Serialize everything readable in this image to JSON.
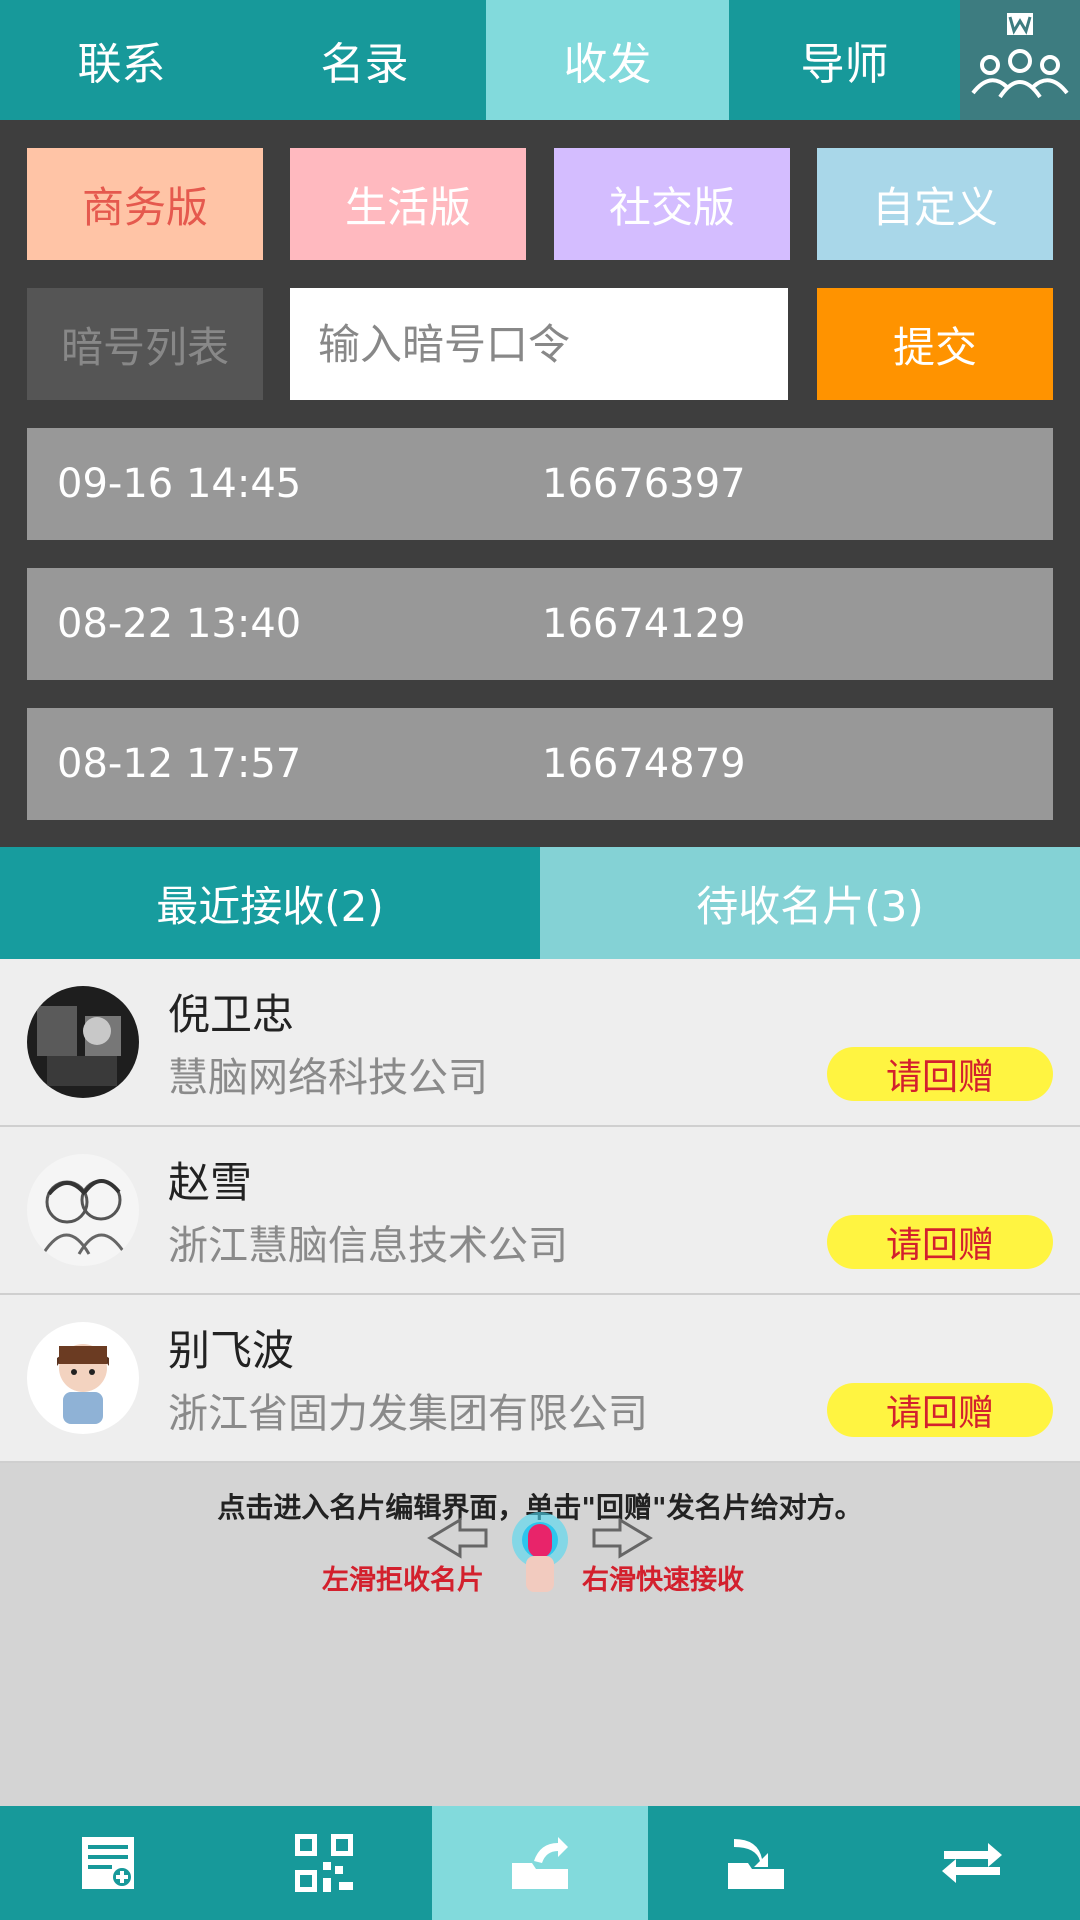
{
  "topnav": {
    "tabs": [
      {
        "label": "联系"
      },
      {
        "label": "名录"
      },
      {
        "label": "收发"
      },
      {
        "label": "导师"
      }
    ],
    "active_tab": 2,
    "profile_icon": "people-group-icon"
  },
  "versions": [
    {
      "label": "商务版"
    },
    {
      "label": "生活版"
    },
    {
      "label": "社交版"
    },
    {
      "label": "自定义"
    }
  ],
  "code_row": {
    "list_label": "暗号列表",
    "input_value": "",
    "input_placeholder": "输入暗号口令",
    "submit_label": "提交"
  },
  "records": [
    {
      "time": "09-16 14:45",
      "code": "16676397"
    },
    {
      "time": "08-22 13:40",
      "code": "16674129"
    },
    {
      "time": "08-12 17:57",
      "code": "16674879"
    }
  ],
  "subtabs": [
    {
      "label": "最近接收(2)"
    },
    {
      "label": "待收名片(3)"
    }
  ],
  "contacts": [
    {
      "name": "倪卫忠",
      "company": "慧脑网络科技公司",
      "action": "请回赠"
    },
    {
      "name": "赵雪",
      "company": "浙江慧脑信息技术公司",
      "action": "请回赠"
    },
    {
      "name": "别飞波",
      "company": "浙江省固力发集团有限公司",
      "action": "请回赠"
    }
  ],
  "hint": {
    "text": "点击进入名片编辑界面，单击\"回赠\"发名片给对方。",
    "left_label": "左滑拒收名片",
    "right_label": "右滑快速接收"
  },
  "bottomnav": {
    "items": [
      {
        "icon": "card-add-icon"
      },
      {
        "icon": "qr-code-icon"
      },
      {
        "icon": "send-folder-icon"
      },
      {
        "icon": "receive-folder-icon"
      },
      {
        "icon": "swap-arrows-icon"
      }
    ],
    "active": 2
  },
  "colors": {
    "teal": "#17999a",
    "teal_light": "#82dadc",
    "orange": "#ff9300",
    "yellow_badge": "#fff441",
    "red_text": "#d3202d"
  }
}
